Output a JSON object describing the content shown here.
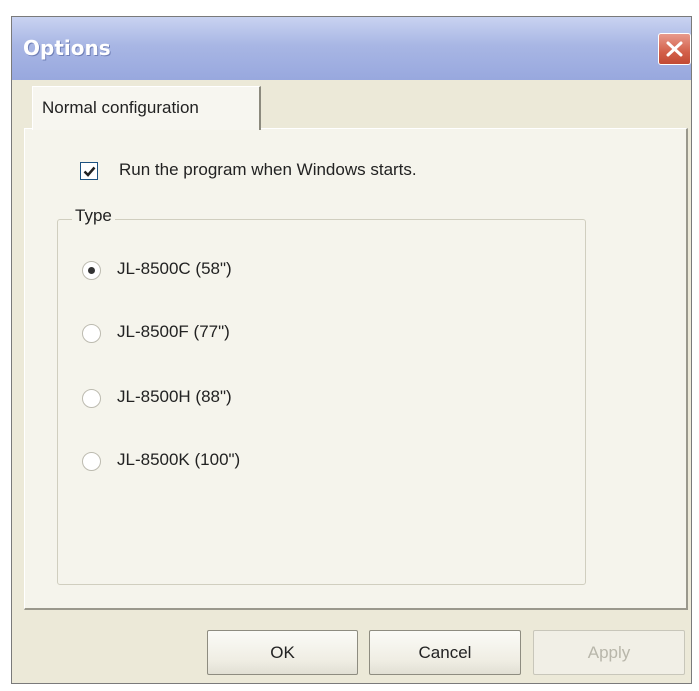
{
  "window": {
    "title": "Options"
  },
  "tabs": [
    {
      "label": "Normal configuration",
      "selected": true
    }
  ],
  "settings": {
    "run_at_startup": {
      "label": "Run the program when Windows starts.",
      "checked": true
    }
  },
  "type_group": {
    "legend": "Type",
    "options": [
      {
        "label": "JL-8500C (58\")",
        "selected": true
      },
      {
        "label": "JL-8500F (77\")",
        "selected": false
      },
      {
        "label": "JL-8500H (88\")",
        "selected": false
      },
      {
        "label": "JL-8500K (100\")",
        "selected": false
      }
    ]
  },
  "buttons": {
    "ok": "OK",
    "cancel": "Cancel",
    "apply": "Apply",
    "apply_enabled": false
  },
  "icons": {
    "close": "close-icon",
    "check": "checkmark-icon"
  },
  "colors": {
    "dialog_background": "#ECE9D8",
    "titlebar": "#A8B6E4",
    "close_button": "#D3604A"
  }
}
